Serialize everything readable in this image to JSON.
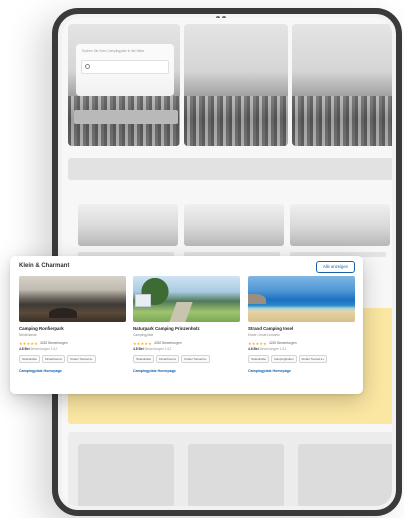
{
  "search": {
    "hint": "Suchen Sie Ihren Campingplatz in der Nähe",
    "placeholder": ""
  },
  "popup": {
    "title": "Klein & Charmant",
    "show_all_label": "Alle anzeigen",
    "campsites": [
      {
        "name": "Camping Ronfierpark",
        "location": "Niederlande",
        "stars": "★★★★★",
        "reviews": "4282 Bewertungen",
        "score": "4.8 Bei",
        "score_sub": "Bewertungen 1/12",
        "tags": [
          "Strandnähe",
          "Kinderfreund.",
          "Kinder Tierseil 2+"
        ],
        "link": "Campingplatz Homepage"
      },
      {
        "name": "Naturpark Camping Prinzenholz",
        "location": "Campingplatz",
        "stars": "★★★★★",
        "reviews": "4282 Bewertungen",
        "score": "4.8 Bei",
        "score_sub": "Bewertungen 1/12",
        "tags": [
          "Strandnähe",
          "Kinderfreund.",
          "Kinder Tierseil 2+"
        ],
        "link": "Campingplatz Homepage"
      },
      {
        "name": "Strand Camping Insel",
        "location": "Küste • Insel Lemonic",
        "stars": "★★★★★",
        "reviews": "4282 Bewertungen",
        "score": "4.8 Bei",
        "score_sub": "Bewertungen 1/12",
        "tags": [
          "Strandnähe",
          "Campinghütten",
          "Kinder Tierseil 2+"
        ],
        "link": "Campingplatz Homepage"
      }
    ]
  },
  "colors": {
    "accent": "#1a63a8",
    "star": "#f2b600",
    "highlight_panel": "#fbe6a2",
    "frame": "#3a3a3a"
  }
}
